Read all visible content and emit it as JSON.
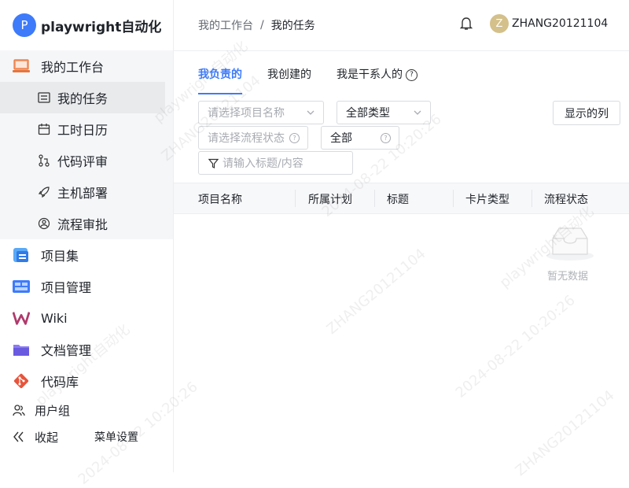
{
  "brand": {
    "logo_letter": "P",
    "name": "playwright自动化"
  },
  "sidebar": {
    "workbench": {
      "label": "我的工作台",
      "icon": "laptop-icon"
    },
    "sub_items": [
      {
        "label": "我的任务",
        "icon": "task-card-icon",
        "active": true
      },
      {
        "label": "工时日历",
        "icon": "calendar-icon"
      },
      {
        "label": "代码评审",
        "icon": "code-review-icon"
      },
      {
        "label": "主机部署",
        "icon": "rocket-icon"
      },
      {
        "label": "流程审批",
        "icon": "approval-icon"
      }
    ],
    "items": [
      {
        "label": "项目集",
        "icon": "project-set-icon"
      },
      {
        "label": "项目管理",
        "icon": "project-management-icon"
      },
      {
        "label": "Wiki",
        "icon": "wiki-icon"
      },
      {
        "label": "文档管理",
        "icon": "folder-icon"
      },
      {
        "label": "代码库",
        "icon": "git-icon"
      }
    ],
    "user_group": "用户组",
    "collapse": "收起",
    "menu_settings": "菜单设置"
  },
  "header": {
    "breadcrumb": [
      "我的工作台",
      "我的任务"
    ],
    "avatar_letter": "Z",
    "username": "ZHANG20121104"
  },
  "tabs": [
    "我负责的",
    "我创建的",
    "我是干系人的"
  ],
  "filters": {
    "project_placeholder": "请选择项目名称",
    "type_value": "全部类型",
    "flow_status_placeholder": "请选择流程状态",
    "status_value": "全部",
    "search_placeholder": "请输入标题/内容"
  },
  "show_columns_label": "显示的列",
  "table": {
    "columns": [
      "项目名称",
      "所属计划",
      "标题",
      "卡片类型",
      "流程状态"
    ],
    "empty_text": "暂无数据"
  },
  "watermark": {
    "lines": [
      "playwright自动化",
      "ZHANG20121104",
      "2024-08-22 10:20:26"
    ]
  }
}
